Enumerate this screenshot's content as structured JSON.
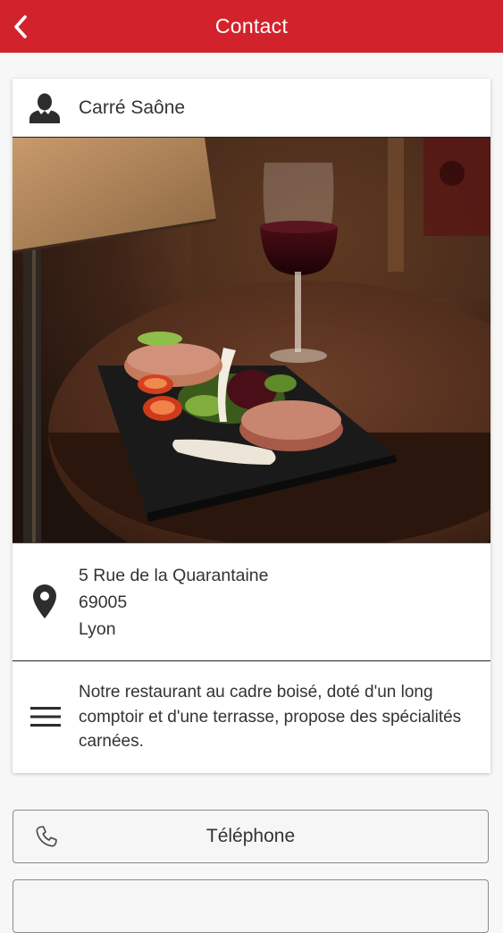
{
  "header": {
    "title": "Contact",
    "bar_color": "#d2232c"
  },
  "place": {
    "name": "Carré Saône",
    "address": {
      "street": "5 Rue de la Quarantaine",
      "postal_code": "69005",
      "city": "Lyon"
    },
    "description": "Notre restaurant au cadre boisé, doté d'un long comptoir et d'une terrasse, propose des spécialités carnées."
  },
  "actions": {
    "phone_label": "Téléphone"
  },
  "icons": {
    "back": "chevron-left-icon",
    "person": "person-icon",
    "location": "map-pin-icon",
    "description": "menu-lines-icon",
    "phone": "phone-icon"
  }
}
